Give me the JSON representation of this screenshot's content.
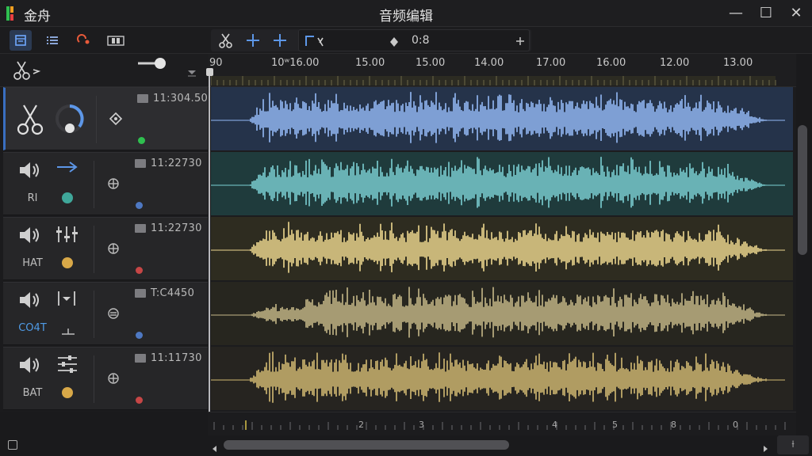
{
  "window": {
    "app_name": "金舟",
    "title": "音频编辑",
    "controls": {
      "minimize": "—",
      "maximize": "☐",
      "close": "✕"
    }
  },
  "toolbar": {
    "icons": [
      "timeline-view-icon",
      "list-view-icon",
      "record-icon",
      "filmstrip-icon"
    ],
    "transport": {
      "position": "0:8"
    }
  },
  "ruler": {
    "labels": [
      "90",
      "10ʷ16.00",
      "15.00",
      "15.00",
      "14.00",
      "17.00",
      "16.00",
      "12.00",
      "13.00"
    ]
  },
  "tracks": [
    {
      "name": "",
      "time": "11:304.50",
      "color": "#7e9fd4",
      "dot": "#2fbf4f",
      "kind": "cut"
    },
    {
      "name": "RI",
      "time": "11:22730",
      "color": "#69b2b5",
      "dot": "#4e78c2",
      "kind": "audio"
    },
    {
      "name": "HAT",
      "time": "11:22730",
      "color": "#c8b679",
      "dot": "#c64646",
      "kind": "audio"
    },
    {
      "name": "CO4T",
      "time": "T:C4450",
      "color": "#a69b73",
      "dot": "#4e78c2",
      "kind": "audio"
    },
    {
      "name": "BAT",
      "time": "11:11730",
      "color": "#b09c62",
      "dot": "#c64646",
      "kind": "audio"
    }
  ],
  "bottom_ruler": {
    "labels": [
      "2",
      "3",
      "4",
      "5",
      "8",
      "0"
    ]
  },
  "corner_button": "⟊",
  "colors": {
    "accent": "#3a6fc1",
    "selected_track_bg": "#2d2d30"
  }
}
